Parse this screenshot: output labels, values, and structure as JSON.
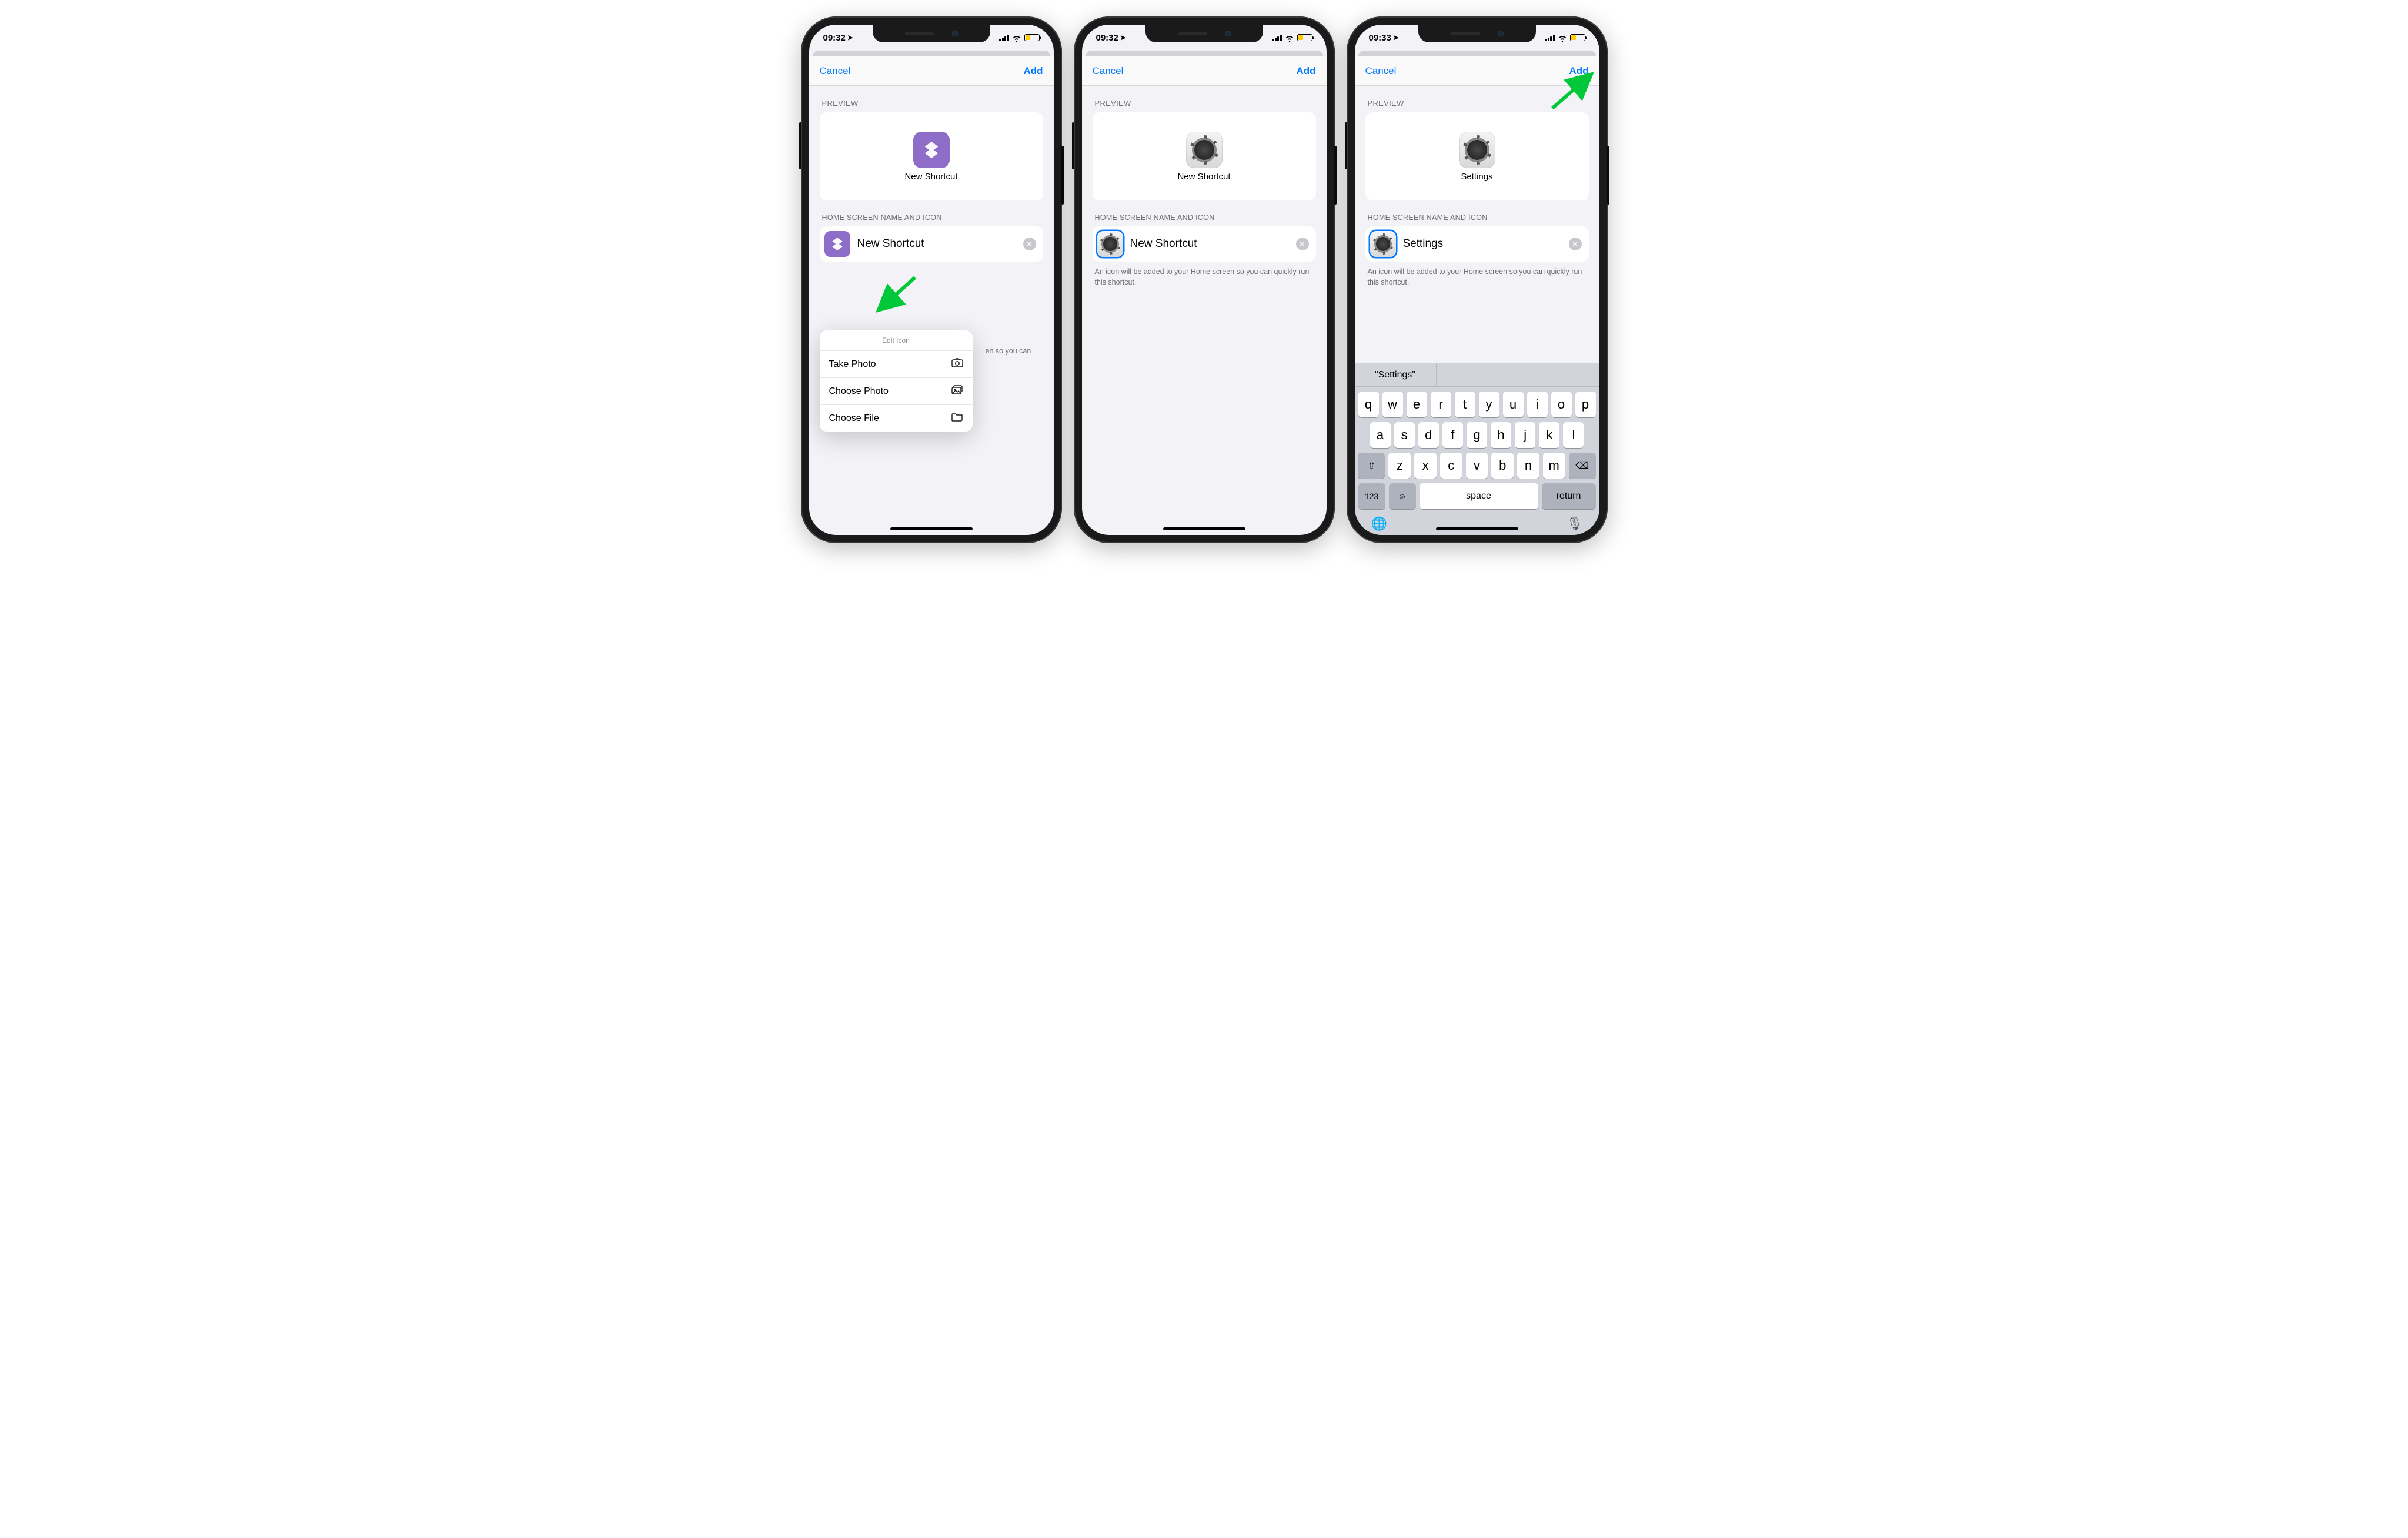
{
  "colors": {
    "accent": "#007aff",
    "arrow": "#00c838",
    "purple_icon": "#8e6dc8",
    "battery_fill": "#ffcc00"
  },
  "nav": {
    "cancel": "Cancel",
    "add": "Add"
  },
  "section": {
    "preview": "PREVIEW",
    "name_icon": "HOME SCREEN NAME AND ICON"
  },
  "help_text": "An icon will be added to your Home screen so you can quickly run this shortcut.",
  "help_text_partial": "en so you can",
  "popover": {
    "title": "Edit Icon",
    "items": [
      {
        "label": "Take Photo",
        "icon": "camera-icon"
      },
      {
        "label": "Choose Photo",
        "icon": "photo-library-icon"
      },
      {
        "label": "Choose File",
        "icon": "folder-icon"
      }
    ]
  },
  "phones": [
    {
      "time": "09:32",
      "preview_label": "New Shortcut",
      "preview_icon": "shortcuts-purple",
      "name_value": "New Shortcut",
      "name_icon": "shortcuts-purple",
      "icon_selected": false,
      "show_popover": true,
      "show_keyboard": false,
      "arrow_target": "name-icon"
    },
    {
      "time": "09:32",
      "preview_label": "New Shortcut",
      "preview_icon": "gear",
      "name_value": "New Shortcut",
      "name_icon": "gear",
      "icon_selected": true,
      "show_popover": false,
      "show_keyboard": false,
      "arrow_target": null
    },
    {
      "time": "09:33",
      "preview_label": "Settings",
      "preview_icon": "gear",
      "name_value": "Settings",
      "name_icon": "gear",
      "icon_selected": true,
      "show_popover": false,
      "show_keyboard": true,
      "arrow_target": "add-button"
    }
  ],
  "keyboard": {
    "suggestion": "\"Settings\"",
    "row1": [
      "q",
      "w",
      "e",
      "r",
      "t",
      "y",
      "u",
      "i",
      "o",
      "p"
    ],
    "row2": [
      "a",
      "s",
      "d",
      "f",
      "g",
      "h",
      "j",
      "k",
      "l"
    ],
    "row3": [
      "z",
      "x",
      "c",
      "v",
      "b",
      "n",
      "m"
    ],
    "num_key": "123",
    "space": "space",
    "return": "return"
  }
}
